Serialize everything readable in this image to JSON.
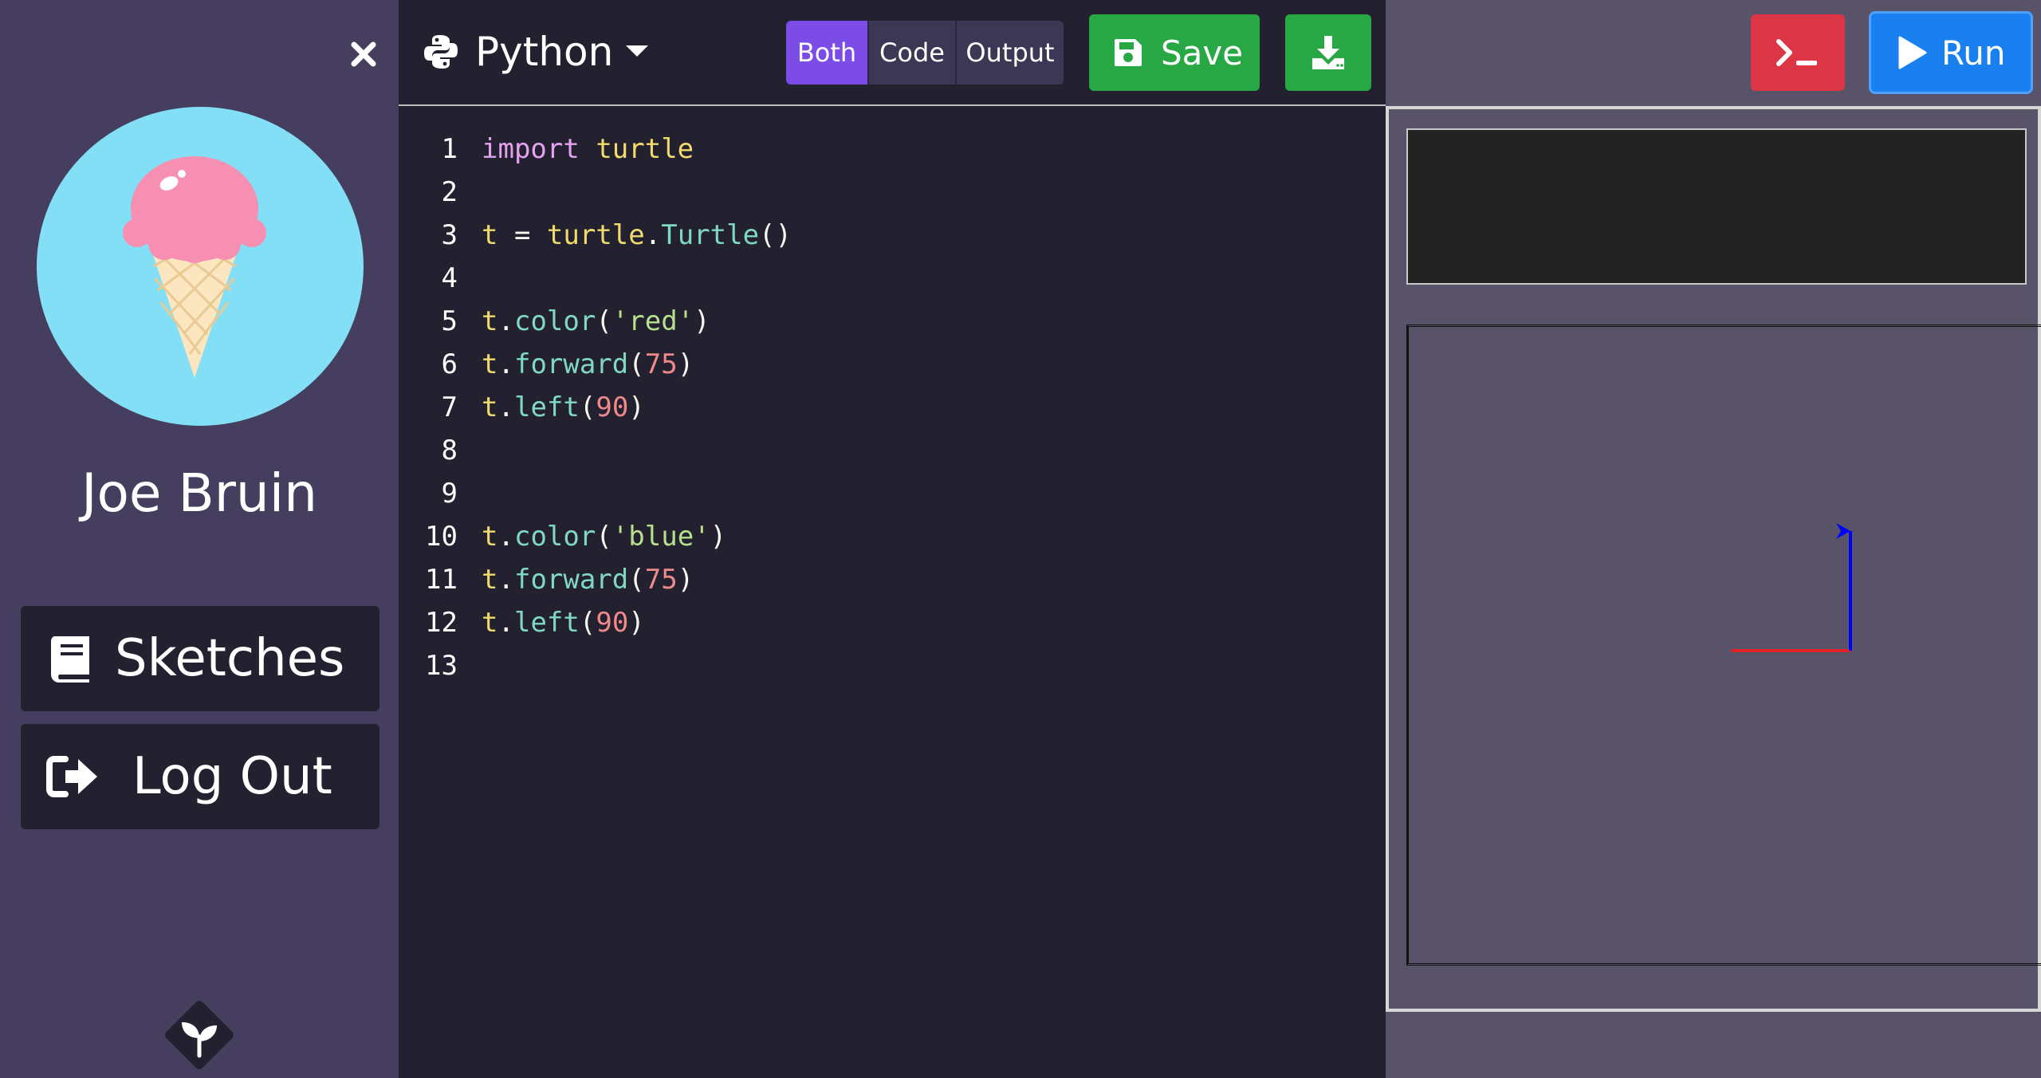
{
  "sidebar": {
    "user_name": "Joe Bruin",
    "sketches_label": "Sketches",
    "logout_label": "Log Out"
  },
  "editor": {
    "language": "Python",
    "view_modes": [
      "Both",
      "Code",
      "Output"
    ],
    "active_view": "Both",
    "save_label": "Save",
    "lines": [
      {
        "num": "1",
        "tokens": [
          {
            "t": "import",
            "c": "kw"
          },
          {
            "t": " ",
            "c": "plain"
          },
          {
            "t": "turtle",
            "c": "mod"
          }
        ]
      },
      {
        "num": "2",
        "tokens": []
      },
      {
        "num": "3",
        "tokens": [
          {
            "t": "t",
            "c": "var"
          },
          {
            "t": " = ",
            "c": "plain"
          },
          {
            "t": "turtle",
            "c": "mod"
          },
          {
            "t": ".",
            "c": "plain"
          },
          {
            "t": "Turtle",
            "c": "fn"
          },
          {
            "t": "()",
            "c": "plain"
          }
        ]
      },
      {
        "num": "4",
        "tokens": []
      },
      {
        "num": "5",
        "tokens": [
          {
            "t": "t",
            "c": "var"
          },
          {
            "t": ".",
            "c": "plain"
          },
          {
            "t": "color",
            "c": "fn"
          },
          {
            "t": "(",
            "c": "plain"
          },
          {
            "t": "'red'",
            "c": "str"
          },
          {
            "t": ")",
            "c": "plain"
          }
        ]
      },
      {
        "num": "6",
        "tokens": [
          {
            "t": "t",
            "c": "var"
          },
          {
            "t": ".",
            "c": "plain"
          },
          {
            "t": "forward",
            "c": "fn"
          },
          {
            "t": "(",
            "c": "plain"
          },
          {
            "t": "75",
            "c": "num"
          },
          {
            "t": ")",
            "c": "plain"
          }
        ]
      },
      {
        "num": "7",
        "tokens": [
          {
            "t": "t",
            "c": "var"
          },
          {
            "t": ".",
            "c": "plain"
          },
          {
            "t": "left",
            "c": "fn"
          },
          {
            "t": "(",
            "c": "plain"
          },
          {
            "t": "90",
            "c": "num"
          },
          {
            "t": ")",
            "c": "plain"
          }
        ]
      },
      {
        "num": "8",
        "tokens": []
      },
      {
        "num": "9",
        "tokens": []
      },
      {
        "num": "10",
        "tokens": [
          {
            "t": "t",
            "c": "var"
          },
          {
            "t": ".",
            "c": "plain"
          },
          {
            "t": "color",
            "c": "fn"
          },
          {
            "t": "(",
            "c": "plain"
          },
          {
            "t": "'blue'",
            "c": "str"
          },
          {
            "t": ")",
            "c": "plain"
          }
        ]
      },
      {
        "num": "11",
        "tokens": [
          {
            "t": "t",
            "c": "var"
          },
          {
            "t": ".",
            "c": "plain"
          },
          {
            "t": "forward",
            "c": "fn"
          },
          {
            "t": "(",
            "c": "plain"
          },
          {
            "t": "75",
            "c": "num"
          },
          {
            "t": ")",
            "c": "plain"
          }
        ]
      },
      {
        "num": "12",
        "tokens": [
          {
            "t": "t",
            "c": "var"
          },
          {
            "t": ".",
            "c": "plain"
          },
          {
            "t": "left",
            "c": "fn"
          },
          {
            "t": "(",
            "c": "plain"
          },
          {
            "t": "90",
            "c": "num"
          },
          {
            "t": ")",
            "c": "plain"
          }
        ]
      },
      {
        "num": "13",
        "tokens": []
      }
    ]
  },
  "output": {
    "run_label": "Run",
    "console_text": "",
    "turtle_segments": [
      {
        "color": "#e0202a",
        "distance": 75,
        "heading": 0
      },
      {
        "color": "#0000ff",
        "distance": 75,
        "heading": 90
      }
    ]
  },
  "icons": {
    "close": "close-icon",
    "python": "python-icon",
    "caret": "caret-down-icon",
    "save": "floppy-disk-icon",
    "download": "download-icon",
    "console": "terminal-icon",
    "run": "play-icon",
    "sketches": "book-icon",
    "logout": "sign-out-icon",
    "brand": "seedling-logo-icon"
  },
  "colors": {
    "sidebar_bg": "#463e5e",
    "editor_bg": "#23202f",
    "output_bg": "#595369",
    "accent_purple": "#7b4ce6",
    "save_green": "#27a844",
    "console_red": "#dc3545",
    "run_blue": "#1a80f0",
    "avatar_bg": "#83dff5"
  }
}
